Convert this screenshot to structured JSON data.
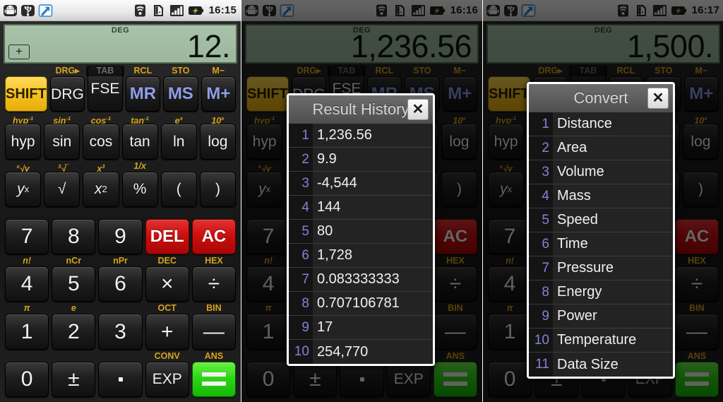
{
  "panels": [
    {
      "id": "panel-1",
      "statusbar": {
        "time": "16:15",
        "icons_left": [
          "android-robot-icon",
          "usb-icon",
          "share-arrow-icon"
        ],
        "icons_right": [
          "wifi-icon",
          "sd-card-icon",
          "signal-bars-icon",
          "battery-charging-icon"
        ]
      },
      "display": {
        "mode": "DEG",
        "memory_indicator": "+",
        "value": "12."
      },
      "dialog": null
    },
    {
      "id": "panel-2",
      "statusbar": {
        "time": "16:16",
        "icons_left": [
          "android-robot-icon",
          "usb-icon",
          "share-arrow-icon"
        ],
        "icons_right": [
          "wifi-icon",
          "sd-card-icon",
          "signal-bars-icon",
          "battery-charging-icon"
        ]
      },
      "display": {
        "mode": "DEG",
        "memory_indicator": "",
        "value": "1,236.56"
      },
      "dialog": {
        "name": "result-history",
        "title": "Result History",
        "close_label": "✕",
        "items": [
          {
            "n": "1",
            "text": "1,236.56"
          },
          {
            "n": "2",
            "text": "9.9"
          },
          {
            "n": "3",
            "text": "-4,544"
          },
          {
            "n": "4",
            "text": "144"
          },
          {
            "n": "5",
            "text": "80"
          },
          {
            "n": "6",
            "text": "1,728"
          },
          {
            "n": "7",
            "text": "0.083333333"
          },
          {
            "n": "8",
            "text": "0.707106781"
          },
          {
            "n": "9",
            "text": "17"
          },
          {
            "n": "10",
            "text": "254,770"
          }
        ]
      }
    },
    {
      "id": "panel-3",
      "statusbar": {
        "time": "16:17",
        "icons_left": [
          "android-robot-icon",
          "usb-icon",
          "share-arrow-icon"
        ],
        "icons_right": [
          "wifi-icon",
          "sd-card-icon",
          "signal-bars-icon",
          "battery-charging-icon"
        ]
      },
      "display": {
        "mode": "DEG",
        "memory_indicator": "",
        "value": "1,500."
      },
      "dialog": {
        "name": "convert",
        "title": "Convert",
        "close_label": "✕",
        "items": [
          {
            "n": "1",
            "text": "Distance"
          },
          {
            "n": "2",
            "text": "Area"
          },
          {
            "n": "3",
            "text": "Volume"
          },
          {
            "n": "4",
            "text": "Mass"
          },
          {
            "n": "5",
            "text": "Speed"
          },
          {
            "n": "6",
            "text": "Time"
          },
          {
            "n": "7",
            "text": "Pressure"
          },
          {
            "n": "8",
            "text": "Energy"
          },
          {
            "n": "9",
            "text": "Power"
          },
          {
            "n": "10",
            "text": "Temperature"
          },
          {
            "n": "11",
            "text": "Data Size"
          }
        ]
      }
    }
  ],
  "keypad": {
    "rows": [
      [
        {
          "shift_label": "",
          "key": "SHIFT",
          "style": "shift"
        },
        {
          "shift_label": "DRG▸",
          "key": "DRG",
          "style": "small"
        },
        {
          "shift_label": "TAB",
          "key": "FSE",
          "style": "small",
          "shift_dim": true
        },
        {
          "shift_label": "RCL",
          "key": "MR",
          "style": "mem"
        },
        {
          "shift_label": "STO",
          "key": "MS",
          "style": "mem"
        },
        {
          "shift_label": "M−",
          "key": "M+",
          "style": "mem"
        }
      ],
      [
        {
          "shift_label": "hyp-1",
          "key": "hyp",
          "style": "sci"
        },
        {
          "shift_label": "sin-1",
          "key": "sin",
          "style": "sci"
        },
        {
          "shift_label": "cos-1",
          "key": "cos",
          "style": "sci"
        },
        {
          "shift_label": "tan-1",
          "key": "tan",
          "style": "sci"
        },
        {
          "shift_label": "ex",
          "key": "ln",
          "style": "sci"
        },
        {
          "shift_label": "10x",
          "key": "log",
          "style": "sci"
        }
      ],
      [
        {
          "shift_label": "x√y",
          "key": "yx",
          "style": "sci"
        },
        {
          "shift_label": "3√",
          "key": "√",
          "style": "sci"
        },
        {
          "shift_label": "x3",
          "key": "x2",
          "style": "sci"
        },
        {
          "shift_label": "1/x",
          "key": "%",
          "style": "sci"
        },
        {
          "shift_label": "",
          "key": "(",
          "style": "sci"
        },
        {
          "shift_label": "",
          "key": ")",
          "style": "sci"
        }
      ],
      [
        {
          "shift_label": "",
          "key": "7",
          "style": "num",
          "span": 1
        },
        {
          "shift_label": "",
          "key": "8",
          "style": "num"
        },
        {
          "shift_label": "",
          "key": "9",
          "style": "num"
        },
        {
          "shift_label": "",
          "key": "DEL",
          "style": "red"
        },
        {
          "shift_label": "",
          "key": "AC",
          "style": "red"
        }
      ],
      [
        {
          "shift_label": "n!",
          "key": "4",
          "style": "num"
        },
        {
          "shift_label": "nCr",
          "key": "5",
          "style": "num"
        },
        {
          "shift_label": "nPr",
          "key": "6",
          "style": "num"
        },
        {
          "shift_label": "DEC",
          "key": "×",
          "style": "num"
        },
        {
          "shift_label": "HEX",
          "key": "÷",
          "style": "num"
        }
      ],
      [
        {
          "shift_label": "π",
          "key": "1",
          "style": "num"
        },
        {
          "shift_label": "e",
          "key": "2",
          "style": "num"
        },
        {
          "shift_label": "",
          "key": "3",
          "style": "num"
        },
        {
          "shift_label": "OCT",
          "key": "+",
          "style": "num"
        },
        {
          "shift_label": "BIN",
          "key": "—",
          "style": "num"
        }
      ],
      [
        {
          "shift_label": "",
          "key": "0",
          "style": "num"
        },
        {
          "shift_label": "",
          "key": "±",
          "style": "num"
        },
        {
          "shift_label": "",
          "key": ".",
          "style": "dot"
        },
        {
          "shift_label": "CONV",
          "key": "EXP",
          "style": "small"
        },
        {
          "shift_label": "ANS",
          "key": "=",
          "style": "green"
        }
      ]
    ]
  }
}
